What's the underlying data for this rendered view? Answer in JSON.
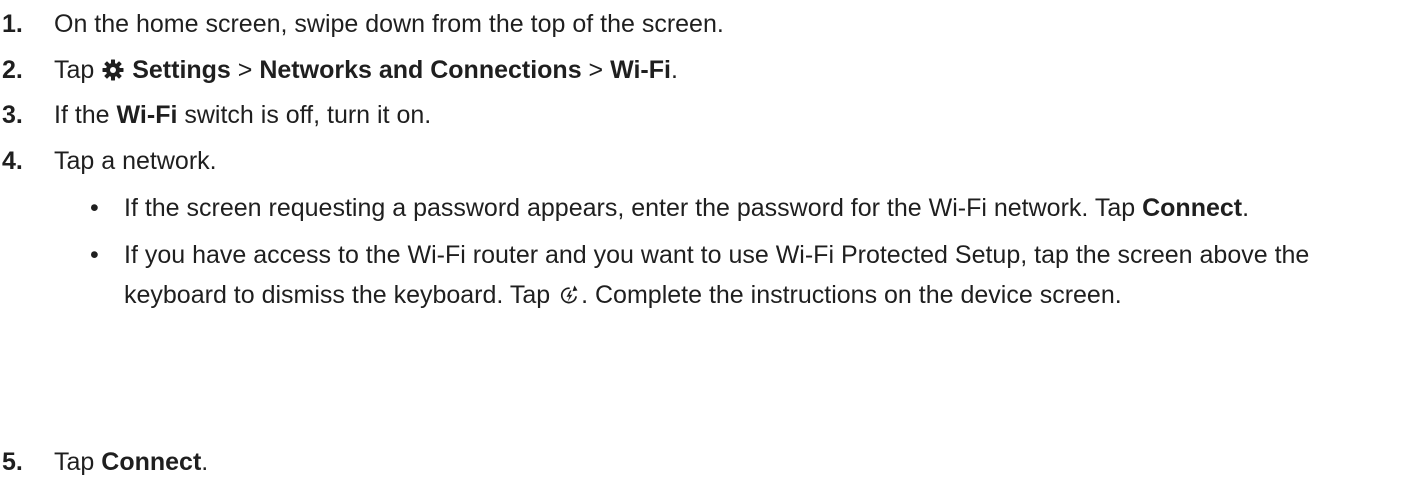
{
  "steps": [
    {
      "number": "1.",
      "text": "On the home screen, swipe down from the top of the screen."
    },
    {
      "number": "2.",
      "prefix": "Tap ",
      "settings_icon": "gear-icon",
      "settings": "Settings",
      "sep1": " > ",
      "networks": "Networks and Connections",
      "sep2": " > ",
      "wifi": "Wi-Fi",
      "end": "."
    },
    {
      "number": "3.",
      "prefix": "If the ",
      "wifi": "Wi-Fi",
      "suffix": " switch is off, turn it on."
    },
    {
      "number": "4.",
      "text": "Tap a network."
    },
    {
      "number": "5.",
      "prefix": "Tap ",
      "connect": "Connect",
      "end": "."
    }
  ],
  "bullets": [
    {
      "text": "If the screen requesting a password appears, enter the password for the Wi-Fi network. Tap ",
      "connect": "Connect",
      "end": "."
    },
    {
      "text1": "If you have access to the Wi-Fi router and you want to use Wi-Fi Protected Setup, tap the screen above the keyboard to dismiss the keyboard. Tap ",
      "wps_icon": "wps-icon",
      "text2": ". Complete the instructions on the device screen."
    }
  ]
}
